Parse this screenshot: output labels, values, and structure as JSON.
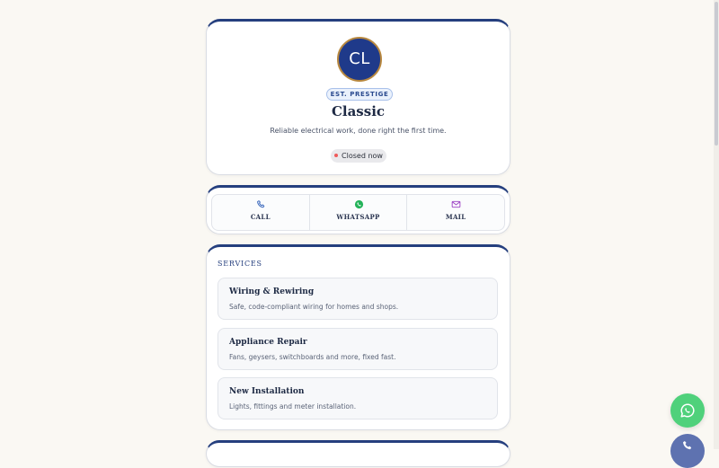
{
  "profile": {
    "initials": "CL",
    "badge": "EST. PRESTIGE",
    "name": "Classic",
    "tagline": "Reliable electrical work, done right the first time.",
    "status": "Closed now",
    "status_color": "#ef5a5a"
  },
  "contact": {
    "buttons": [
      {
        "label": "CALL",
        "icon": "phone-icon",
        "color": "#2f5fb8"
      },
      {
        "label": "WHATSAPP",
        "icon": "whatsapp-icon",
        "color": "#25b35a"
      },
      {
        "label": "MAIL",
        "icon": "mail-icon",
        "color": "#9b3fc4"
      }
    ]
  },
  "services": {
    "title": "SERVICES",
    "items": [
      {
        "name": "Wiring & Rewiring",
        "description": "Safe, code-compliant wiring for homes and shops."
      },
      {
        "name": "Appliance Repair",
        "description": "Fans, geysers, switchboards and more, fixed fast."
      },
      {
        "name": "New Installation",
        "description": "Lights, fittings and meter installation."
      }
    ]
  },
  "floating": {
    "whatsapp_icon": "whatsapp-icon",
    "whatsapp_color": "#4fd17b",
    "call_icon": "phone-icon",
    "call_color": "#5e72b0"
  },
  "theme": {
    "accent": "#253f7e",
    "background": "#faf8f3"
  }
}
